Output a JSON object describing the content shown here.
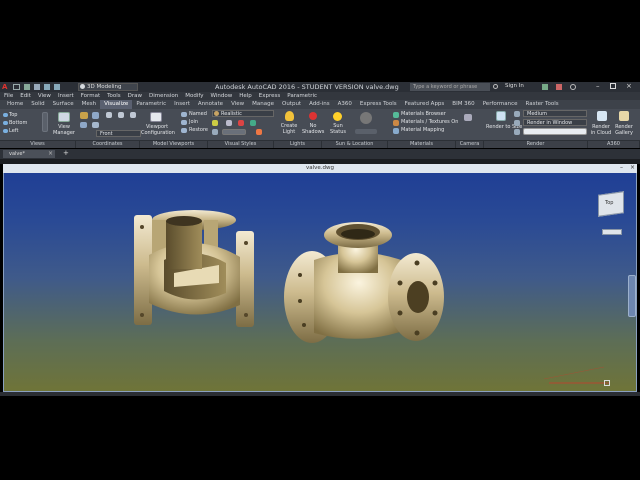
{
  "window": {
    "workspace": "3D Modeling",
    "title": "Autodesk AutoCAD 2016 - STUDENT VERSION    valve.dwg",
    "search_placeholder": "Type a keyword or phrase",
    "user": "Sign In"
  },
  "menus": [
    "File",
    "Edit",
    "View",
    "Insert",
    "Format",
    "Tools",
    "Draw",
    "Dimension",
    "Modify",
    "Window",
    "Help",
    "Express",
    "Parametric"
  ],
  "tabs": [
    "Home",
    "Solid",
    "Surface",
    "Mesh",
    "Visualize",
    "Parametric",
    "Insert",
    "Annotate",
    "View",
    "Manage",
    "Output",
    "Add-ins",
    "A360",
    "Express Tools",
    "Featured Apps",
    "BIM 360",
    "Performance",
    "Raster Tools"
  ],
  "active_tab": "Visualize",
  "ribbon": {
    "views": [
      "Top",
      "Bottom",
      "Left"
    ],
    "view_manager": "View Manager",
    "ucs_front": "Front",
    "viewport_config": "Viewport Configuration",
    "named": "Named",
    "join": "Join",
    "restore": "Restore",
    "visual_style": "Realistic",
    "create_light": "Create Light",
    "no_shadows": "No Shadows",
    "sun_status": "Sun Status",
    "materials_browser": "Materials Browser",
    "materials_textures": "Materials / Textures On",
    "material_mapping": "Material Mapping",
    "render_to_size": "Render to Size",
    "render_preset": "Medium",
    "render_in_window": "Render in Window",
    "render_cloud": "Render in Cloud",
    "render_gallery": "Render Gallery"
  },
  "panels": [
    "Views",
    "Coordinates",
    "Model Viewports",
    "Visual Styles",
    "Lights",
    "Sun & Location",
    "Materials",
    "Camera",
    "Render",
    "A360"
  ],
  "doc_tab": "valve*",
  "viewport_title": "valve.dwg",
  "viewcube_label": "Top",
  "colors": {
    "accent": "#3d6fb6",
    "valve_metal": "#d8c9a0"
  }
}
